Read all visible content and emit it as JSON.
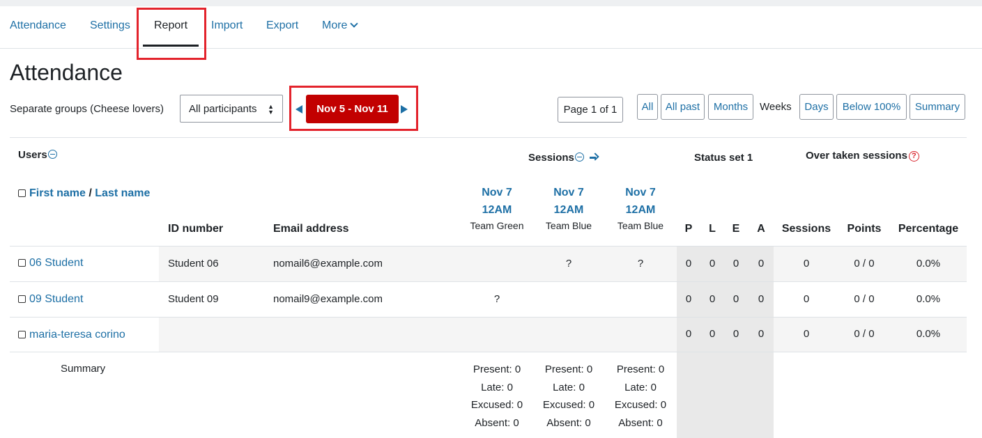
{
  "nav": {
    "tabs": [
      {
        "label": "Attendance"
      },
      {
        "label": "Settings"
      },
      {
        "label": "Report"
      },
      {
        "label": "Import"
      },
      {
        "label": "Export"
      },
      {
        "label": "More"
      }
    ],
    "active": "Report"
  },
  "page": {
    "title": "Attendance",
    "group_label": "Separate groups (Cheese lovers)",
    "group_select": "All participants",
    "date_range": "Nov 5 - Nov 11",
    "page_indicator": "Page 1 of 1",
    "views": [
      "All",
      "All past",
      "Months",
      "Weeks",
      "Days",
      "Below 100%",
      "Summary"
    ],
    "current_view": "Weeks"
  },
  "table": {
    "users_header": "Users",
    "sessions_header": "Sessions",
    "status_set_header": "Status set 1",
    "over_taken_header": "Over taken sessions",
    "first_name": "First name",
    "name_separator": "/",
    "last_name": "Last name",
    "id_header": "ID number",
    "email_header": "Email address",
    "sessions": [
      {
        "date": "Nov 7",
        "time": "12AM",
        "group": "Team Green"
      },
      {
        "date": "Nov 7",
        "time": "12AM",
        "group": "Team Blue"
      },
      {
        "date": "Nov 7",
        "time": "12AM",
        "group": "Team Blue"
      }
    ],
    "status_letters": [
      "P",
      "L",
      "E",
      "A"
    ],
    "stat_headers": [
      "Sessions",
      "Points",
      "Percentage"
    ],
    "rows": [
      {
        "name": "06 Student",
        "id": "Student 06",
        "email": "nomail6@example.com",
        "s": [
          "",
          "?",
          "?"
        ],
        "p": "0",
        "l": "0",
        "e": "0",
        "a": "0",
        "sessions": "0",
        "points": "0 / 0",
        "pct": "0.0%"
      },
      {
        "name": "09 Student",
        "id": "Student 09",
        "email": "nomail9@example.com",
        "s": [
          "?",
          "",
          ""
        ],
        "p": "0",
        "l": "0",
        "e": "0",
        "a": "0",
        "sessions": "0",
        "points": "0 / 0",
        "pct": "0.0%"
      },
      {
        "name": "maria-teresa corino",
        "id": "",
        "email": "",
        "s": [
          "",
          "",
          ""
        ],
        "p": "0",
        "l": "0",
        "e": "0",
        "a": "0",
        "sessions": "0",
        "points": "0 / 0",
        "pct": "0.0%"
      }
    ],
    "summary_label": "Summary",
    "summary": [
      [
        "Present: 0",
        "Late: 0",
        "Excused: 0",
        "Absent: 0"
      ],
      [
        "Present: 0",
        "Late: 0",
        "Excused: 0",
        "Absent: 0"
      ],
      [
        "Present: 0",
        "Late: 0",
        "Excused: 0",
        "Absent: 0"
      ]
    ]
  },
  "colors": {
    "accent": "#1d6fa5",
    "date_button": "#c20000",
    "highlight_box": "#e3232c"
  }
}
